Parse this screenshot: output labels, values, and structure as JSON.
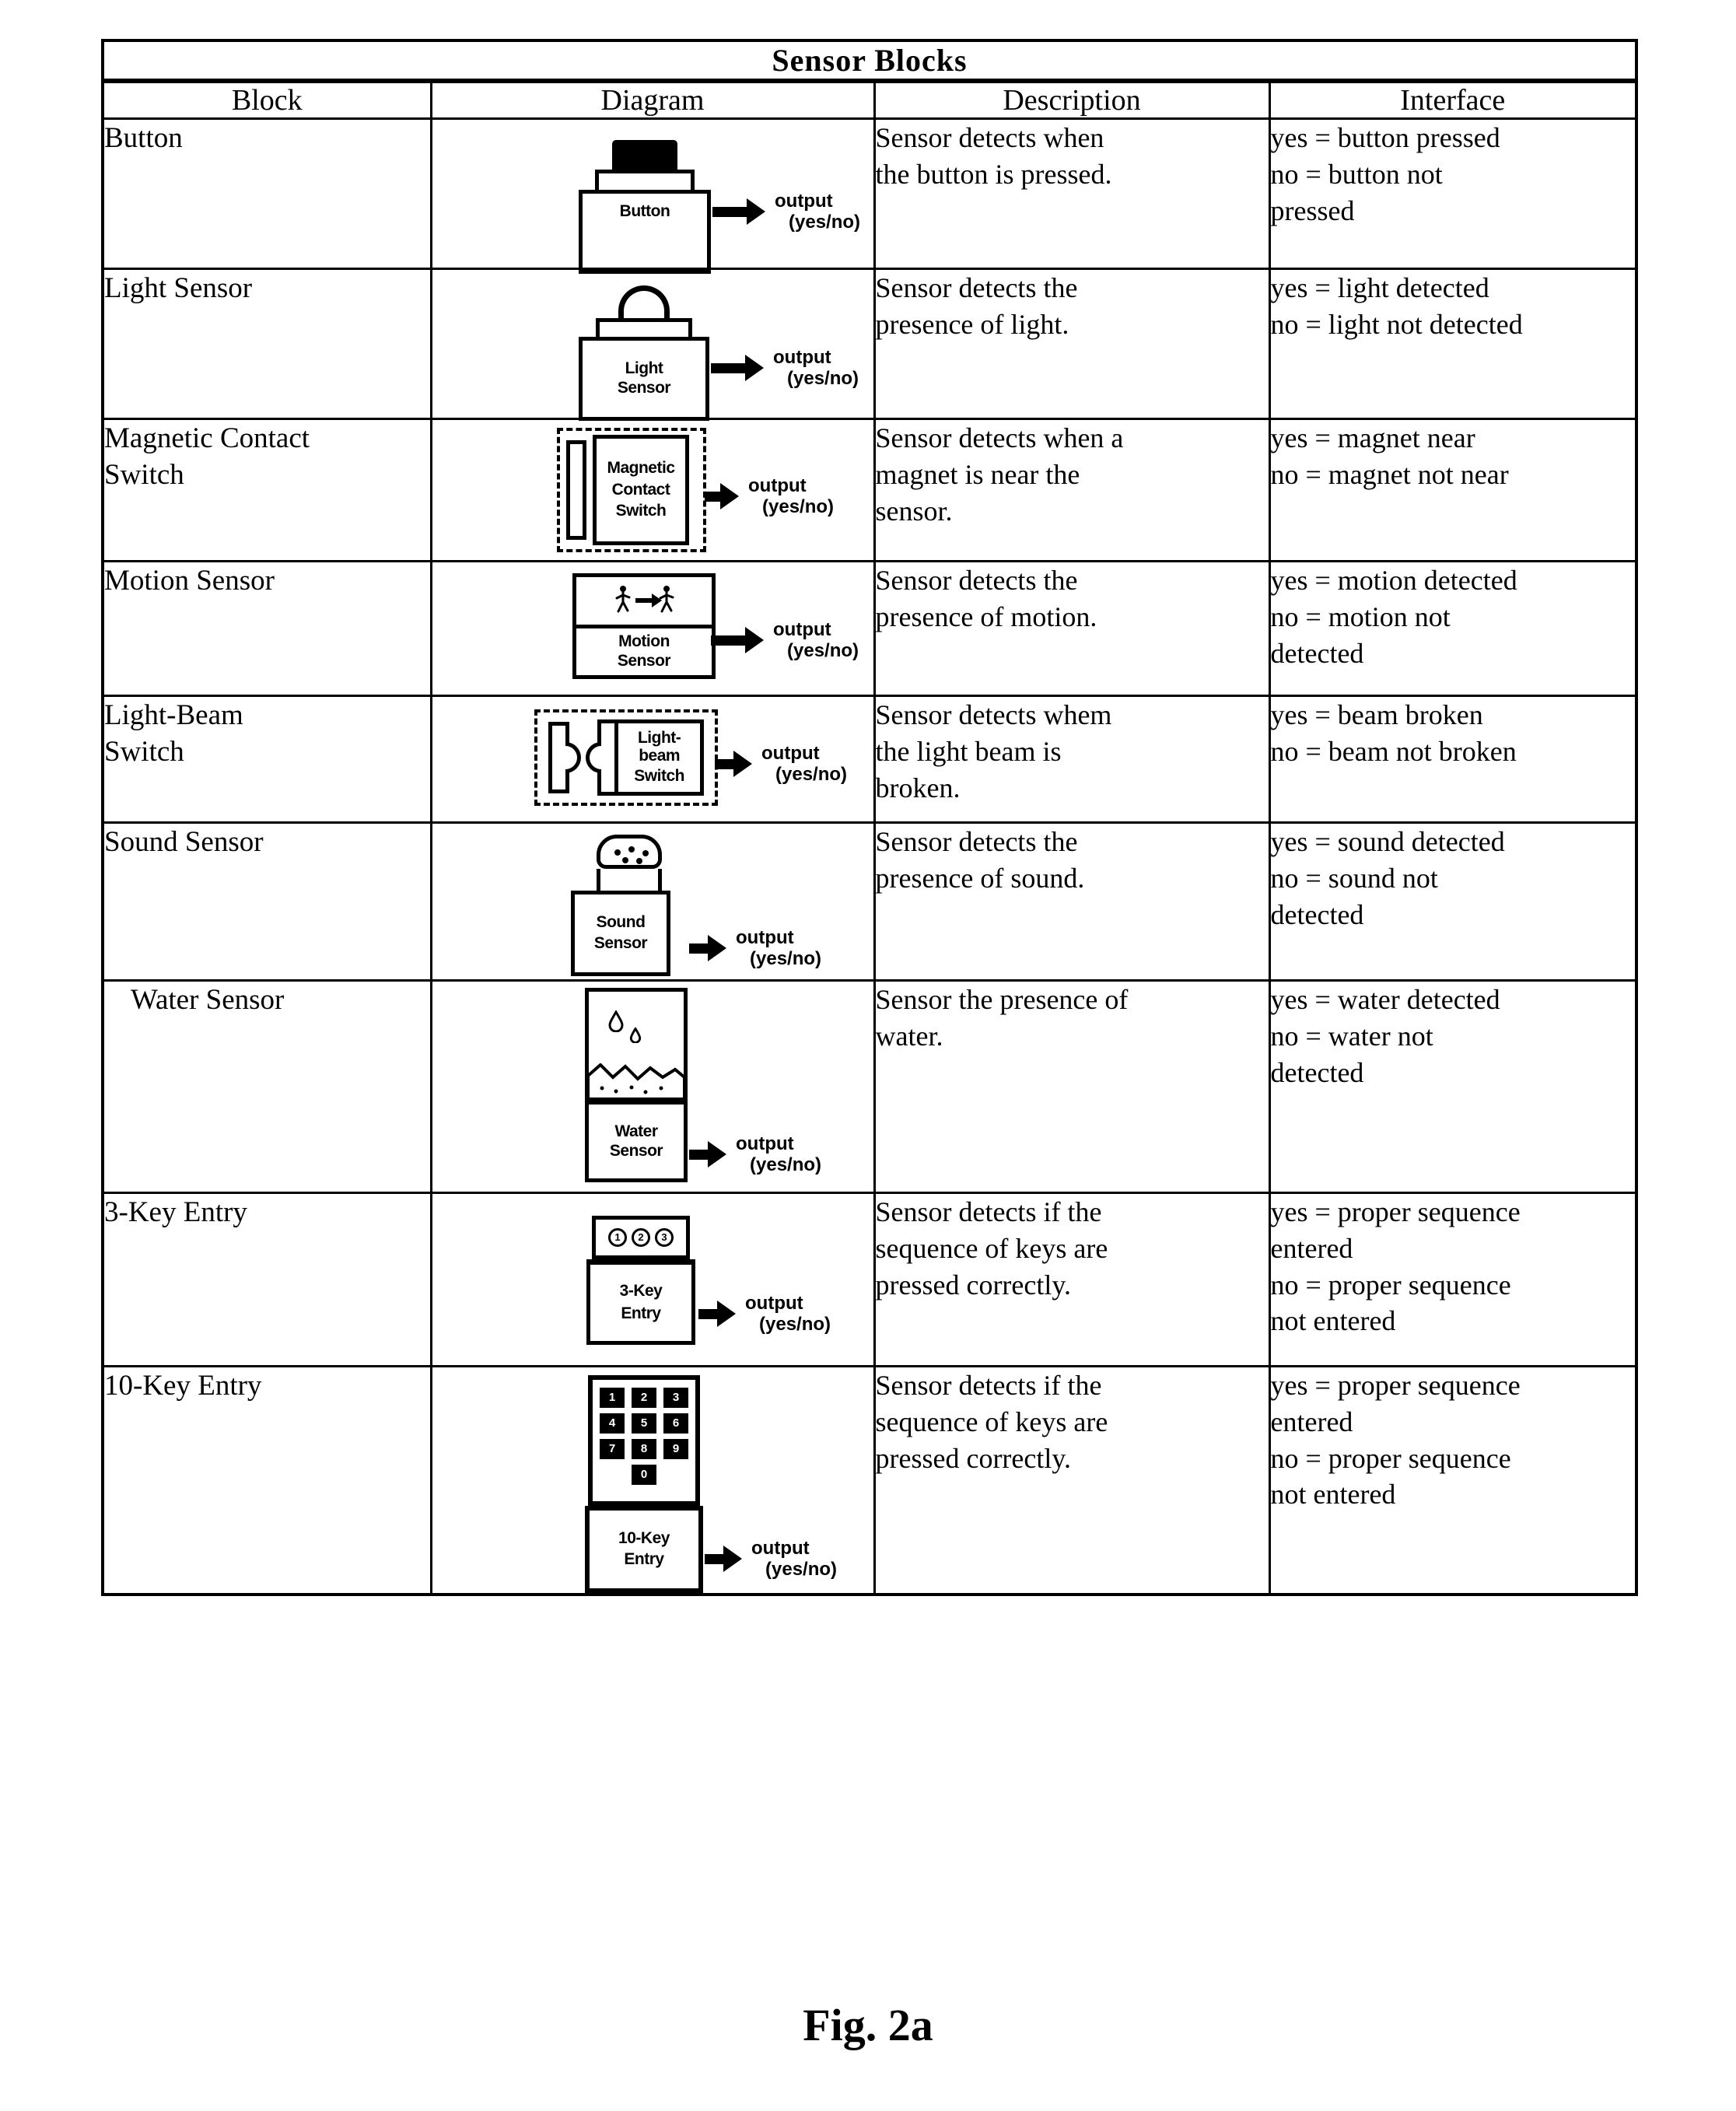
{
  "table": {
    "title": "Sensor  Blocks",
    "columns": [
      "Block",
      "Diagram",
      "Description",
      "Interface"
    ],
    "rows": [
      {
        "block": "Button",
        "diagram": {
          "kind": "button-sensor",
          "label_lines": [
            "Button"
          ],
          "output_line1": "output",
          "output_line2": "(yes/no)"
        },
        "description": [
          "Sensor detects when",
          "the button is pressed."
        ],
        "interface": [
          "yes = button pressed",
          "no = button not",
          "pressed"
        ]
      },
      {
        "block": "Light Sensor",
        "diagram": {
          "kind": "light-sensor",
          "label_lines": [
            "Light",
            "Sensor"
          ],
          "output_line1": "output",
          "output_line2": "(yes/no)"
        },
        "description": [
          "Sensor detects the",
          "presence of light."
        ],
        "interface": [
          "yes = light detected",
          "no = light not detected"
        ]
      },
      {
        "block": "Magnetic Contact Switch",
        "block_lines": [
          "Magnetic Contact",
          "Switch"
        ],
        "diagram": {
          "kind": "magnetic-contact-switch",
          "label_lines": [
            "Magnetic",
            "Contact",
            "Switch"
          ],
          "output_line1": "output",
          "output_line2": "(yes/no)"
        },
        "description": [
          "Sensor detects when a",
          "magnet is near the",
          "sensor."
        ],
        "interface": [
          "yes = magnet near",
          "no = magnet not near"
        ]
      },
      {
        "block": "Motion Sensor",
        "diagram": {
          "kind": "motion-sensor",
          "label_lines": [
            "Motion",
            "Sensor"
          ],
          "output_line1": "output",
          "output_line2": "(yes/no)"
        },
        "description": [
          "Sensor detects the",
          "presence of motion."
        ],
        "interface": [
          "yes = motion detected",
          "no = motion not",
          "detected"
        ]
      },
      {
        "block": "Light-Beam Switch",
        "block_lines": [
          "Light-Beam",
          "Switch"
        ],
        "diagram": {
          "kind": "light-beam-switch",
          "label_lines": [
            "Light-beam",
            "Switch"
          ],
          "output_line1": "output",
          "output_line2": "(yes/no)"
        },
        "description": [
          "Sensor detects whem",
          "the light beam is",
          "broken."
        ],
        "interface": [
          "yes = beam broken",
          "no = beam not broken"
        ]
      },
      {
        "block": "Sound Sensor",
        "diagram": {
          "kind": "sound-sensor",
          "label_lines": [
            "Sound",
            "Sensor"
          ],
          "output_line1": "output",
          "output_line2": "(yes/no)"
        },
        "description": [
          "Sensor detects the",
          "presence of sound."
        ],
        "interface": [
          "yes = sound detected",
          "no = sound not",
          "detected"
        ]
      },
      {
        "block": " Water Sensor",
        "diagram": {
          "kind": "water-sensor",
          "label_lines": [
            "Water",
            "Sensor"
          ],
          "output_line1": "output",
          "output_line2": "(yes/no)"
        },
        "description": [
          "Sensor the presence of",
          "water."
        ],
        "interface": [
          "yes = water detected",
          "no = water not",
          "detected"
        ]
      },
      {
        "block": "3-Key Entry",
        "diagram": {
          "kind": "three-key-entry",
          "keys": [
            "1",
            "2",
            "3"
          ],
          "label_lines": [
            "3-Key",
            "Entry"
          ],
          "output_line1": "output",
          "output_line2": "(yes/no)"
        },
        "description": [
          "Sensor detects if the",
          "sequence of keys are",
          "pressed correctly."
        ],
        "interface": [
          "yes = proper sequence",
          "entered",
          "no = proper sequence",
          "not entered"
        ]
      },
      {
        "block": "10-Key Entry",
        "diagram": {
          "kind": "ten-key-entry",
          "keys": [
            "1",
            "2",
            "3",
            "4",
            "5",
            "6",
            "7",
            "8",
            "9"
          ],
          "zero_key": "0",
          "label_lines": [
            "10-Key",
            "Entry"
          ],
          "output_line1": "output",
          "output_line2": "(yes/no)"
        },
        "description": [
          "Sensor detects if the",
          "sequence of keys are",
          "pressed correctly."
        ],
        "interface": [
          "yes = proper sequence",
          "entered",
          "no = proper sequence",
          "not entered"
        ]
      }
    ]
  },
  "figure": {
    "caption": "Fig. 2a"
  }
}
